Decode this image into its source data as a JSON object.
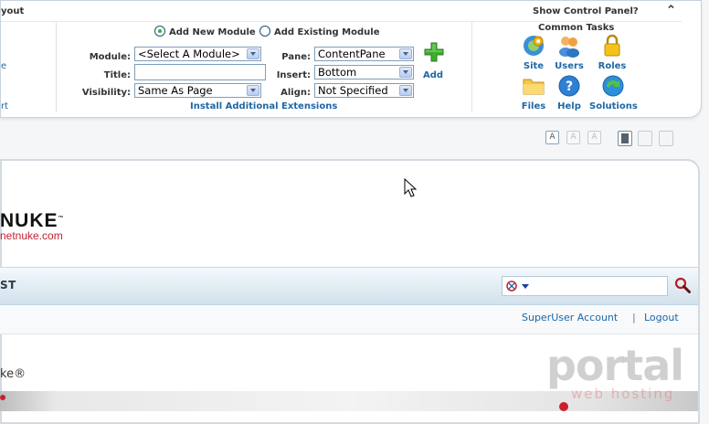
{
  "control_panel": {
    "edge_top_left": "yout",
    "edge_mid_1": "e",
    "edge_mid_2": "rt",
    "show_control_panel": "Show Control Panel?",
    "collapse_glyph": "⌃",
    "add_new_module": "Add New Module",
    "add_existing_module": "Add Existing Module",
    "module_label": "Module:",
    "module_value": "<Select A Module>",
    "title_label": "Title:",
    "title_value": "",
    "visibility_label": "Visibility:",
    "visibility_value": "Same As Page",
    "pane_label": "Pane:",
    "pane_value": "ContentPane",
    "insert_label": "Insert:",
    "insert_value": "Bottom",
    "align_label": "Align:",
    "align_value": "Not Specified",
    "add_label": "Add",
    "install_extensions": "Install Additional Extensions",
    "common_tasks": "Common Tasks",
    "tasks": [
      {
        "label": "Site",
        "icon": "site-gear-icon"
      },
      {
        "label": "Users",
        "icon": "users-icon"
      },
      {
        "label": "Roles",
        "icon": "roles-lock-icon"
      },
      {
        "label": "Files",
        "icon": "folder-icon"
      },
      {
        "label": "Help",
        "icon": "help-icon"
      },
      {
        "label": "Solutions",
        "icon": "solutions-icon"
      }
    ]
  },
  "toolbar": {
    "font_buttons": [
      "A",
      "A",
      "A"
    ]
  },
  "site": {
    "logo_text": "NUKE",
    "logo_tm": "™",
    "logo_url": "netnuke.com",
    "nav_item": "ST",
    "superuser_account": "SuperUser Account",
    "separator": "|",
    "logout": "Logout",
    "content_text": "ke®"
  },
  "watermark": {
    "main": "portal",
    "sub": "web hosting"
  },
  "colors": {
    "link_blue": "#1f67a6",
    "add_green": "#3dae2b",
    "logo_red": "#c8202f"
  }
}
